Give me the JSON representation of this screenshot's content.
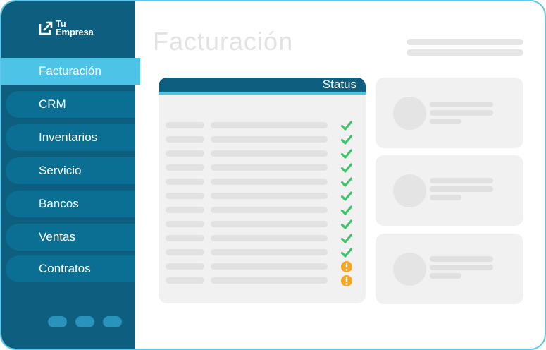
{
  "brand": {
    "line1": "Tu",
    "line2": "Empresa"
  },
  "sidebar": {
    "items": [
      {
        "label": "Facturación",
        "active": true
      },
      {
        "label": "CRM",
        "active": false
      },
      {
        "label": "Inventarios",
        "active": false
      },
      {
        "label": "Servicio",
        "active": false
      },
      {
        "label": "Bancos",
        "active": false
      },
      {
        "label": "Ventas",
        "active": false
      },
      {
        "label": "Contratos",
        "active": false
      }
    ]
  },
  "main": {
    "title": "Facturación",
    "table": {
      "status_header": "Status",
      "rows": [
        {
          "status": "check"
        },
        {
          "status": "check"
        },
        {
          "status": "check"
        },
        {
          "status": "check"
        },
        {
          "status": "check"
        },
        {
          "status": "check"
        },
        {
          "status": "check"
        },
        {
          "status": "check"
        },
        {
          "status": "check"
        },
        {
          "status": "check"
        },
        {
          "status": "warning"
        },
        {
          "status": "warning"
        }
      ]
    }
  },
  "colors": {
    "sidebar": "#0e5f7f",
    "accent": "#4dc3e6",
    "check": "#3cc46a",
    "warning": "#f5a623"
  }
}
